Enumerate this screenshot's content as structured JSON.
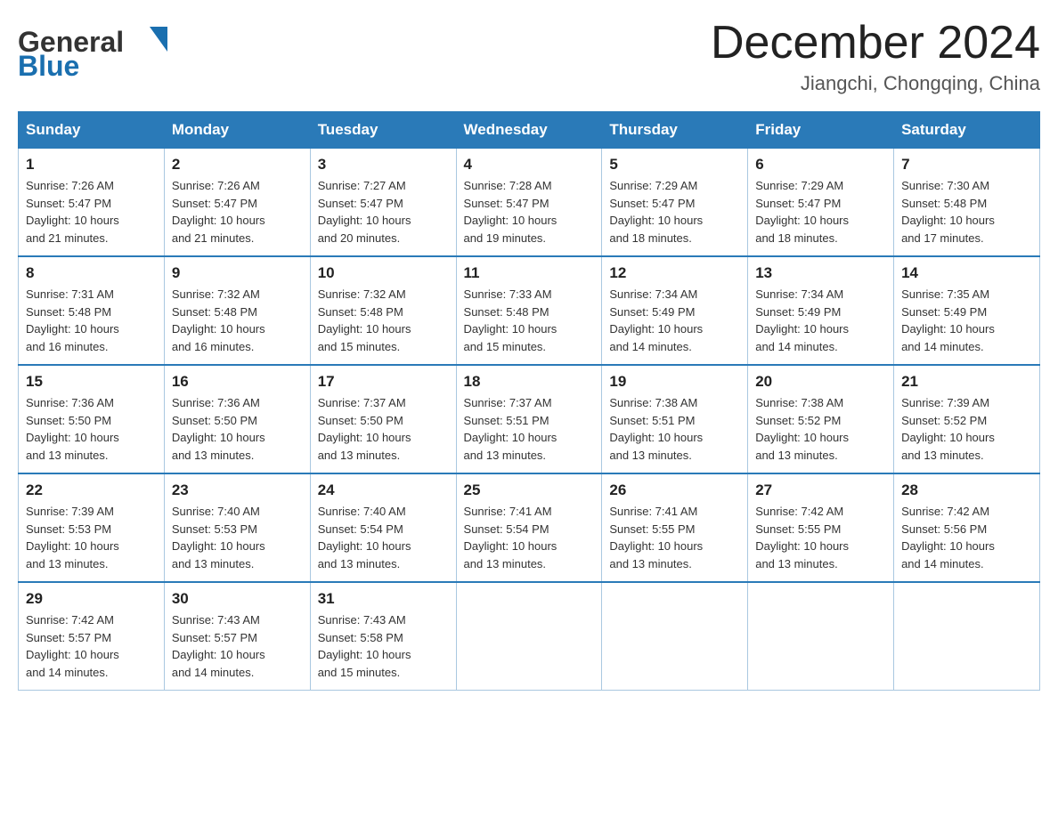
{
  "header": {
    "logo_general": "General",
    "logo_blue": "Blue",
    "month_title": "December 2024",
    "location": "Jiangchi, Chongqing, China"
  },
  "days_of_week": [
    "Sunday",
    "Monday",
    "Tuesday",
    "Wednesday",
    "Thursday",
    "Friday",
    "Saturday"
  ],
  "weeks": [
    [
      {
        "day": "1",
        "sunrise": "7:26 AM",
        "sunset": "5:47 PM",
        "daylight": "10 hours and 21 minutes."
      },
      {
        "day": "2",
        "sunrise": "7:26 AM",
        "sunset": "5:47 PM",
        "daylight": "10 hours and 21 minutes."
      },
      {
        "day": "3",
        "sunrise": "7:27 AM",
        "sunset": "5:47 PM",
        "daylight": "10 hours and 20 minutes."
      },
      {
        "day": "4",
        "sunrise": "7:28 AM",
        "sunset": "5:47 PM",
        "daylight": "10 hours and 19 minutes."
      },
      {
        "day": "5",
        "sunrise": "7:29 AM",
        "sunset": "5:47 PM",
        "daylight": "10 hours and 18 minutes."
      },
      {
        "day": "6",
        "sunrise": "7:29 AM",
        "sunset": "5:47 PM",
        "daylight": "10 hours and 18 minutes."
      },
      {
        "day": "7",
        "sunrise": "7:30 AM",
        "sunset": "5:48 PM",
        "daylight": "10 hours and 17 minutes."
      }
    ],
    [
      {
        "day": "8",
        "sunrise": "7:31 AM",
        "sunset": "5:48 PM",
        "daylight": "10 hours and 16 minutes."
      },
      {
        "day": "9",
        "sunrise": "7:32 AM",
        "sunset": "5:48 PM",
        "daylight": "10 hours and 16 minutes."
      },
      {
        "day": "10",
        "sunrise": "7:32 AM",
        "sunset": "5:48 PM",
        "daylight": "10 hours and 15 minutes."
      },
      {
        "day": "11",
        "sunrise": "7:33 AM",
        "sunset": "5:48 PM",
        "daylight": "10 hours and 15 minutes."
      },
      {
        "day": "12",
        "sunrise": "7:34 AM",
        "sunset": "5:49 PM",
        "daylight": "10 hours and 14 minutes."
      },
      {
        "day": "13",
        "sunrise": "7:34 AM",
        "sunset": "5:49 PM",
        "daylight": "10 hours and 14 minutes."
      },
      {
        "day": "14",
        "sunrise": "7:35 AM",
        "sunset": "5:49 PM",
        "daylight": "10 hours and 14 minutes."
      }
    ],
    [
      {
        "day": "15",
        "sunrise": "7:36 AM",
        "sunset": "5:50 PM",
        "daylight": "10 hours and 13 minutes."
      },
      {
        "day": "16",
        "sunrise": "7:36 AM",
        "sunset": "5:50 PM",
        "daylight": "10 hours and 13 minutes."
      },
      {
        "day": "17",
        "sunrise": "7:37 AM",
        "sunset": "5:50 PM",
        "daylight": "10 hours and 13 minutes."
      },
      {
        "day": "18",
        "sunrise": "7:37 AM",
        "sunset": "5:51 PM",
        "daylight": "10 hours and 13 minutes."
      },
      {
        "day": "19",
        "sunrise": "7:38 AM",
        "sunset": "5:51 PM",
        "daylight": "10 hours and 13 minutes."
      },
      {
        "day": "20",
        "sunrise": "7:38 AM",
        "sunset": "5:52 PM",
        "daylight": "10 hours and 13 minutes."
      },
      {
        "day": "21",
        "sunrise": "7:39 AM",
        "sunset": "5:52 PM",
        "daylight": "10 hours and 13 minutes."
      }
    ],
    [
      {
        "day": "22",
        "sunrise": "7:39 AM",
        "sunset": "5:53 PM",
        "daylight": "10 hours and 13 minutes."
      },
      {
        "day": "23",
        "sunrise": "7:40 AM",
        "sunset": "5:53 PM",
        "daylight": "10 hours and 13 minutes."
      },
      {
        "day": "24",
        "sunrise": "7:40 AM",
        "sunset": "5:54 PM",
        "daylight": "10 hours and 13 minutes."
      },
      {
        "day": "25",
        "sunrise": "7:41 AM",
        "sunset": "5:54 PM",
        "daylight": "10 hours and 13 minutes."
      },
      {
        "day": "26",
        "sunrise": "7:41 AM",
        "sunset": "5:55 PM",
        "daylight": "10 hours and 13 minutes."
      },
      {
        "day": "27",
        "sunrise": "7:42 AM",
        "sunset": "5:55 PM",
        "daylight": "10 hours and 13 minutes."
      },
      {
        "day": "28",
        "sunrise": "7:42 AM",
        "sunset": "5:56 PM",
        "daylight": "10 hours and 14 minutes."
      }
    ],
    [
      {
        "day": "29",
        "sunrise": "7:42 AM",
        "sunset": "5:57 PM",
        "daylight": "10 hours and 14 minutes."
      },
      {
        "day": "30",
        "sunrise": "7:43 AM",
        "sunset": "5:57 PM",
        "daylight": "10 hours and 14 minutes."
      },
      {
        "day": "31",
        "sunrise": "7:43 AM",
        "sunset": "5:58 PM",
        "daylight": "10 hours and 15 minutes."
      },
      null,
      null,
      null,
      null
    ]
  ],
  "labels": {
    "sunrise": "Sunrise:",
    "sunset": "Sunset:",
    "daylight": "Daylight:"
  }
}
